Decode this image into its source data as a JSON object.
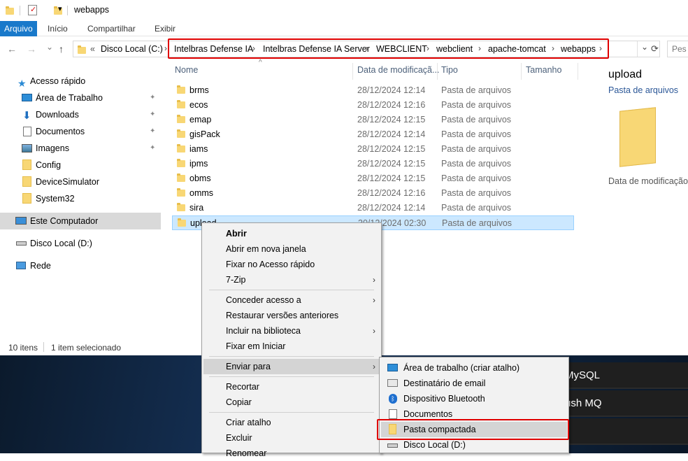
{
  "window": {
    "title": "webapps",
    "qat_dropdown": "▾"
  },
  "ribbon": {
    "tabs": [
      "Arquivo",
      "Início",
      "Compartilhar",
      "Exibir"
    ]
  },
  "nav": {
    "back": "←",
    "forward": "→",
    "recent": "⌄",
    "up": "↑",
    "overflow": "«",
    "breadcrumbs": [
      "Disco Local (C:)",
      "Intelbras Defense IA",
      "Intelbras Defense IA Server",
      "WEBCLIENT",
      "webclient",
      "apache-tomcat",
      "webapps"
    ],
    "separator": "›",
    "search_placeholder": "Pes",
    "refresh": "⟳"
  },
  "sidebar": {
    "quick_access": "Acesso rápido",
    "items": [
      {
        "label": "Área de Trabalho",
        "icon": "desktop-icon",
        "pinned": true
      },
      {
        "label": "Downloads",
        "icon": "download-icon",
        "pinned": true
      },
      {
        "label": "Documentos",
        "icon": "documents-icon",
        "pinned": true
      },
      {
        "label": "Imagens",
        "icon": "pictures-icon",
        "pinned": true
      },
      {
        "label": "Config",
        "icon": "folder-icon",
        "pinned": false
      },
      {
        "label": "DeviceSimulator",
        "icon": "folder-icon",
        "pinned": false
      },
      {
        "label": "System32",
        "icon": "folder-icon",
        "pinned": false
      }
    ],
    "this_pc": "Este Computador",
    "drive_d": "Disco Local (D:)",
    "network": "Rede",
    "pin_glyph": "📌"
  },
  "columns": {
    "name": "Nome",
    "date": "Data de modificaçã...",
    "type": "Tipo",
    "size": "Tamanho"
  },
  "files": [
    {
      "name": "brms",
      "date": "28/12/2024 12:14",
      "type": "Pasta de arquivos"
    },
    {
      "name": "ecos",
      "date": "28/12/2024 12:16",
      "type": "Pasta de arquivos"
    },
    {
      "name": "emap",
      "date": "28/12/2024 12:15",
      "type": "Pasta de arquivos"
    },
    {
      "name": "gisPack",
      "date": "28/12/2024 12:14",
      "type": "Pasta de arquivos"
    },
    {
      "name": "iams",
      "date": "28/12/2024 12:15",
      "type": "Pasta de arquivos"
    },
    {
      "name": "ipms",
      "date": "28/12/2024 12:15",
      "type": "Pasta de arquivos"
    },
    {
      "name": "obms",
      "date": "28/12/2024 12:15",
      "type": "Pasta de arquivos"
    },
    {
      "name": "omms",
      "date": "28/12/2024 12:16",
      "type": "Pasta de arquivos"
    },
    {
      "name": "sira",
      "date": "28/12/2024 12:14",
      "type": "Pasta de arquivos"
    },
    {
      "name": "upload",
      "date": "30/12/2024 02:30",
      "type": "Pasta de arquivos"
    }
  ],
  "preview": {
    "name": "upload",
    "type": "Pasta de arquivos",
    "date_label": "Data de modificação:"
  },
  "status": {
    "count": "10 itens",
    "selected": "1 item selecionado"
  },
  "desktop_tiles": [
    "MySQL",
    "ush MQ"
  ],
  "context_menu": {
    "items": [
      "Abrir",
      "Abrir em nova janela",
      "Fixar no Acesso rápido",
      "7-Zip",
      "Conceder acesso a",
      "Restaurar versões anteriores",
      "Incluir na biblioteca",
      "Fixar em Iniciar",
      "Enviar para",
      "Recortar",
      "Copiar",
      "Criar atalho",
      "Excluir",
      "Renomear"
    ],
    "arrow": "›"
  },
  "send_to_menu": {
    "items": [
      {
        "label": "Área de trabalho (criar atalho)",
        "icon": "desktop-icon"
      },
      {
        "label": "Destinatário de email",
        "icon": "mail-icon"
      },
      {
        "label": "Dispositivo Bluetooth",
        "icon": "bluetooth-icon"
      },
      {
        "label": "Documentos",
        "icon": "documents-icon"
      },
      {
        "label": "Pasta compactada",
        "icon": "zip-folder-icon"
      },
      {
        "label": "Disco Local (D:)",
        "icon": "drive-icon"
      }
    ]
  },
  "colors": {
    "accent": "#1979ca",
    "highlight_box": "#e00000",
    "selection": "#cce8ff",
    "folder": "#f8d775"
  }
}
